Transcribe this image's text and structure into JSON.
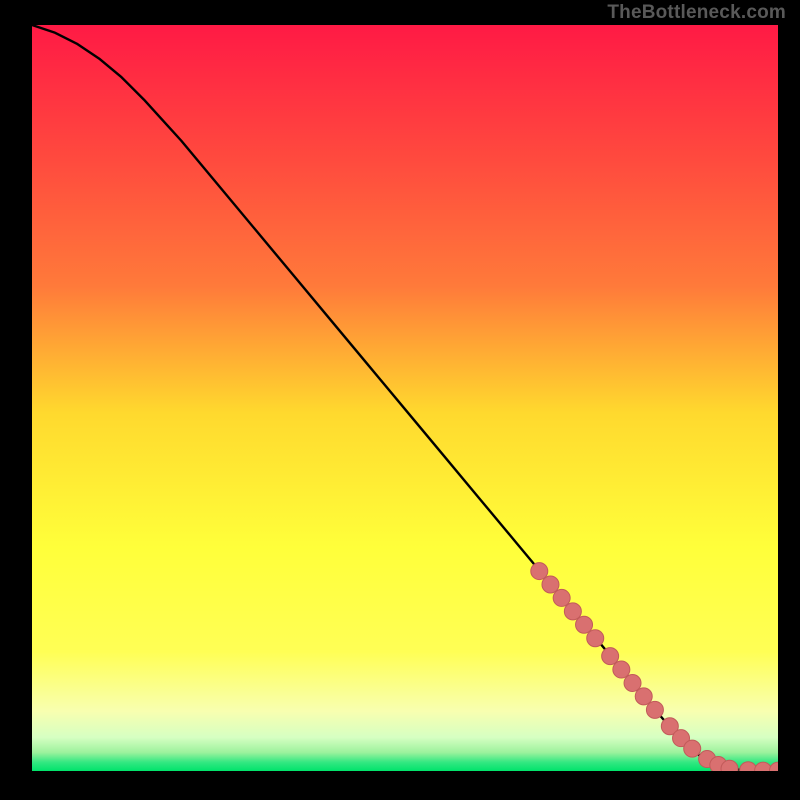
{
  "watermark": "TheBottleneck.com",
  "colors": {
    "bg": "#000000",
    "gradient_top": "#ff1a45",
    "gradient_mid_upper": "#ff7a3a",
    "gradient_mid": "#ffd92e",
    "gradient_mid_lower": "#ffff55",
    "gradient_lower": "#f8ffb0",
    "gradient_band": "#9df29d",
    "gradient_bottom": "#00e36b",
    "curve": "#000000",
    "marker_fill": "#d97070",
    "marker_stroke": "#c25a5a"
  },
  "chart_data": {
    "type": "line",
    "title": "",
    "xlabel": "",
    "ylabel": "",
    "xlim": [
      0,
      100
    ],
    "ylim": [
      0,
      100
    ],
    "series": [
      {
        "name": "curve",
        "x": [
          0,
          3,
          6,
          9,
          12,
          15,
          20,
          25,
          30,
          35,
          40,
          45,
          50,
          55,
          60,
          65,
          70,
          75,
          80,
          83,
          85,
          87,
          89,
          90,
          92,
          95,
          98,
          100
        ],
        "y": [
          100,
          99,
          97.5,
          95.5,
          93,
          90,
          84.5,
          78.5,
          72.5,
          66.5,
          60.5,
          54.5,
          48.5,
          42.5,
          36.5,
          30.5,
          24.5,
          18.5,
          12.5,
          8.8,
          6.5,
          4.3,
          2.5,
          1.6,
          0.6,
          0.15,
          0.05,
          0.05
        ]
      },
      {
        "name": "markers",
        "x": [
          68,
          69.5,
          71,
          72.5,
          74,
          75.5,
          77.5,
          79,
          80.5,
          82,
          83.5,
          85.5,
          87,
          88.5,
          90.5,
          92,
          93.5,
          96,
          98,
          100
        ],
        "y": [
          26.8,
          25.0,
          23.2,
          21.4,
          19.6,
          17.8,
          15.4,
          13.6,
          11.8,
          10.0,
          8.2,
          6.0,
          4.4,
          3.0,
          1.6,
          0.8,
          0.3,
          0.1,
          0.05,
          0.05
        ]
      }
    ]
  }
}
